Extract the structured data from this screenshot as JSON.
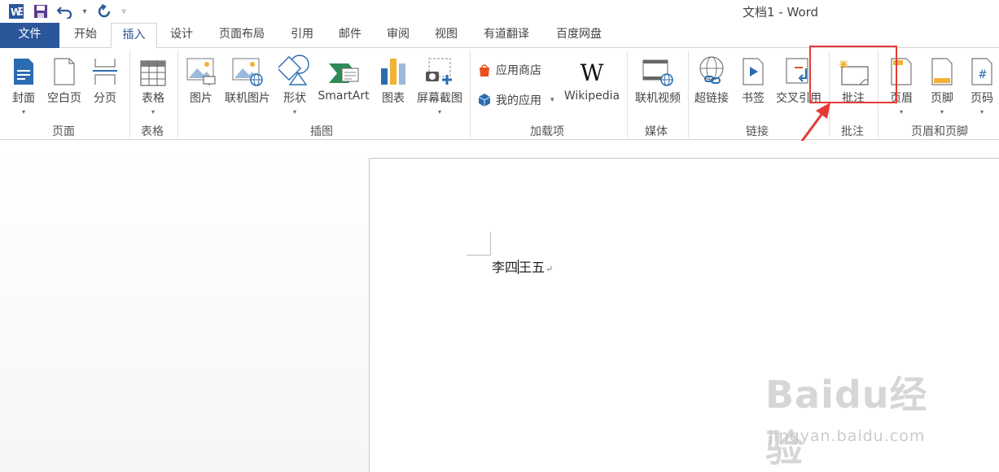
{
  "window": {
    "title": "文档1 - Word"
  },
  "tabs": [
    {
      "label": "文件"
    },
    {
      "label": "开始"
    },
    {
      "label": "插入"
    },
    {
      "label": "设计"
    },
    {
      "label": "页面布局"
    },
    {
      "label": "引用"
    },
    {
      "label": "邮件"
    },
    {
      "label": "审阅"
    },
    {
      "label": "视图"
    },
    {
      "label": "有道翻译"
    },
    {
      "label": "百度网盘"
    }
  ],
  "ribbon": {
    "groups": {
      "pages": "页面",
      "tables": "表格",
      "illustrations": "插图",
      "addins": "加载项",
      "media": "媒体",
      "links": "链接",
      "comments": "批注",
      "header_footer": "页眉和页脚"
    },
    "buttons": {
      "cover": "封面",
      "blank_page": "空白页",
      "page_break": "分页",
      "table": "表格",
      "picture": "图片",
      "online_picture": "联机图片",
      "shapes": "形状",
      "smartart": "SmartArt",
      "chart": "图表",
      "screenshot": "屏幕截图",
      "app_store": "应用商店",
      "my_apps": "我的应用",
      "wikipedia": "Wikipedia",
      "online_video": "联机视频",
      "hyperlink": "超链接",
      "bookmark": "书签",
      "cross_reference": "交叉引用",
      "comment": "批注",
      "header": "页眉",
      "footer": "页脚",
      "page_number": "页码"
    },
    "wikipedia_glyph": "W"
  },
  "document": {
    "text_before": "李四",
    "text_after": "王五",
    "para_mark": "↵"
  },
  "watermark": {
    "logo": "Baidu经验",
    "url": "jingyan.baidu.com"
  },
  "colors": {
    "file_tab": "#2b579a",
    "highlight": "#e53935"
  }
}
